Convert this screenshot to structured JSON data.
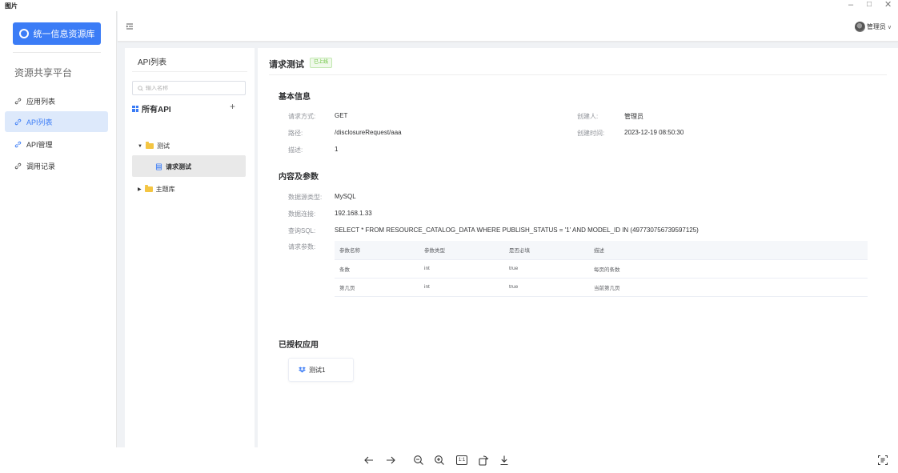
{
  "viewer": {
    "title": "图片",
    "window_controls": {
      "minimize": "–",
      "maximize": "□",
      "close": "✕"
    },
    "toolbar": [
      "arrow-left-icon",
      "arrow-right-icon",
      "zoom-out-icon",
      "zoom-in-icon",
      "actual-size-icon",
      "rotate-icon",
      "download-icon",
      "ocr-icon"
    ],
    "actual_size_label": "1:1"
  },
  "sidebar": {
    "logo_label": "统一信息资源库",
    "platform_title": "资源共享平台",
    "items": [
      {
        "label": "应用列表",
        "icon": "link-icon",
        "active": false
      },
      {
        "label": "API列表",
        "icon": "link-icon",
        "active": true
      },
      {
        "label": "API管理",
        "icon": "link-icon",
        "active": false
      },
      {
        "label": "调用记录",
        "icon": "link-icon",
        "active": false
      }
    ],
    "accent": "#3b7cf6"
  },
  "header": {
    "user_name": "管理员",
    "user_arrow": "∨"
  },
  "tree": {
    "title": "API列表",
    "search_placeholder": "输入名称",
    "root_label": "所有API",
    "add_label": "+",
    "nodes": [
      {
        "label": "测试",
        "expanded": true,
        "children": [
          {
            "label": "请求测试",
            "selected": true
          }
        ]
      },
      {
        "label": "主题库",
        "expanded": false
      }
    ]
  },
  "detail": {
    "title": "请求测试",
    "status_tag": "已上线",
    "basic_section": "基本信息",
    "basic": {
      "method_label": "请求方式:",
      "method_value": "GET",
      "creator_label": "创建人:",
      "creator_value": "管理员",
      "path_label": "路径:",
      "path_value": "/disclosureRequest/aaa",
      "created_label": "创建时间:",
      "created_value": "2023-12-19 08:50:30",
      "desc_label": "描述:",
      "desc_value": "1"
    },
    "content_section": "内容及参数",
    "content": {
      "ds_type_label": "数据源类型:",
      "ds_type_value": "MySQL",
      "ds_conn_label": "数据连接:",
      "ds_conn_value": "192.168.1.33",
      "sql_label": "查询SQL:",
      "sql_value": "SELECT * FROM RESOURCE_CATALOG_DATA WHERE PUBLISH_STATUS = '1' AND MODEL_ID IN (497730756739597125)",
      "params_label": "请求参数:"
    },
    "params_table": {
      "headers": [
        "参数名称",
        "参数类型",
        "是否必填",
        "描述"
      ],
      "rows": [
        [
          "条数",
          "int",
          "true",
          "每页的条数"
        ],
        [
          "第几页",
          "int",
          "true",
          "当前第几页"
        ]
      ]
    },
    "auth_section": "已授权应用",
    "auth_apps": [
      {
        "label": "测试1",
        "icon": "dropbox-icon"
      }
    ]
  }
}
